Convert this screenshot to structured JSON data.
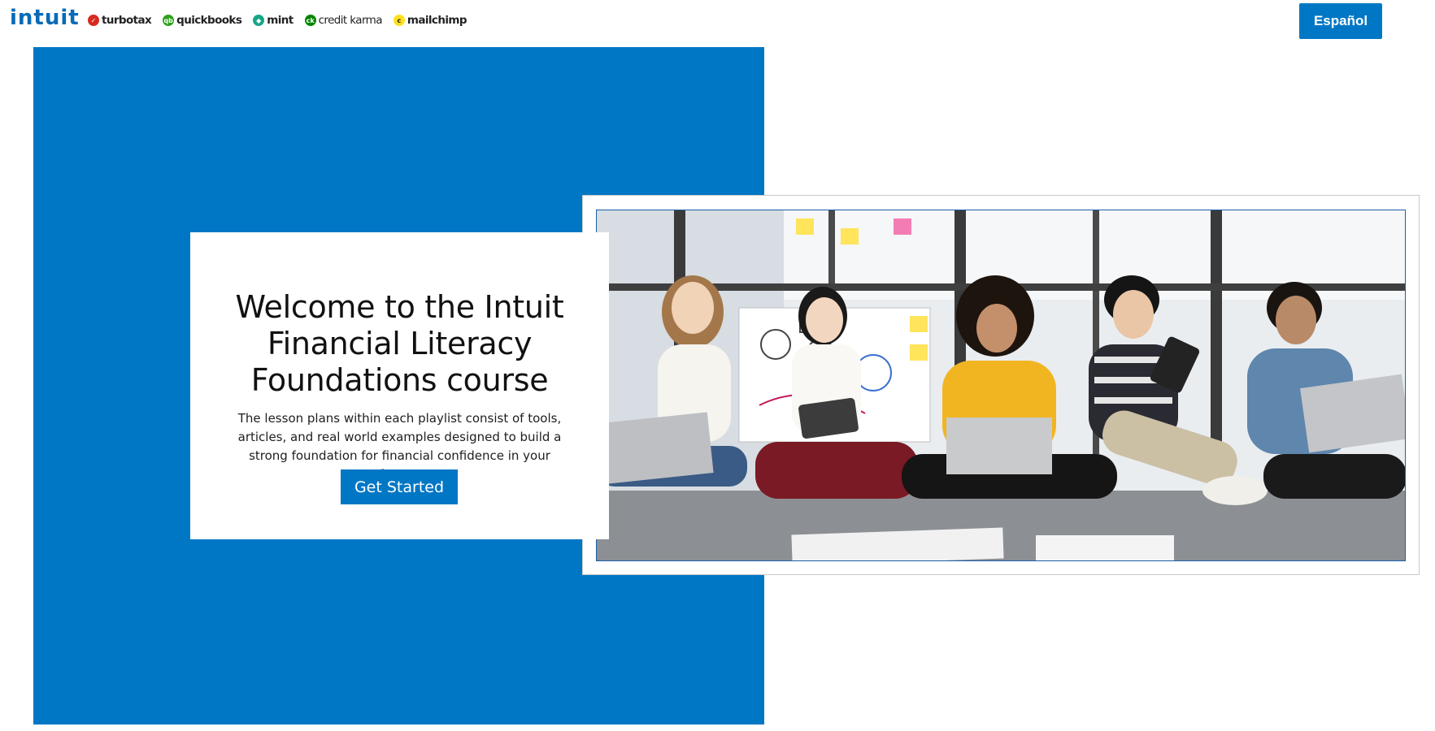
{
  "header": {
    "logo_text": "intuit",
    "brands": [
      {
        "label": "turbotax",
        "icon": "turbotax-check-icon",
        "mark": "✓",
        "color": "#D52B1E"
      },
      {
        "label": "quickbooks",
        "icon": "quickbooks-qb-icon",
        "mark": "qb",
        "color": "#2CA01C"
      },
      {
        "label": "mint",
        "icon": "mint-leaf-icon",
        "mark": "◆",
        "color": "#18A689"
      },
      {
        "label": "credit karma",
        "icon": "credit-karma-ck-icon",
        "mark": "ck",
        "color": "#008600"
      },
      {
        "label": "mailchimp",
        "icon": "mailchimp-freddie-icon",
        "mark": "c",
        "color": "#FFE01B"
      }
    ],
    "language_button": "Español"
  },
  "hero": {
    "title": "Welcome to the Intuit Financial Literacy Foundations course",
    "body": "The lesson plans within each playlist consist of tools, articles, and real world examples designed to build a strong foundation for financial confidence in your future.",
    "cta_label": "Get Started",
    "accent_color": "#0077C5"
  }
}
